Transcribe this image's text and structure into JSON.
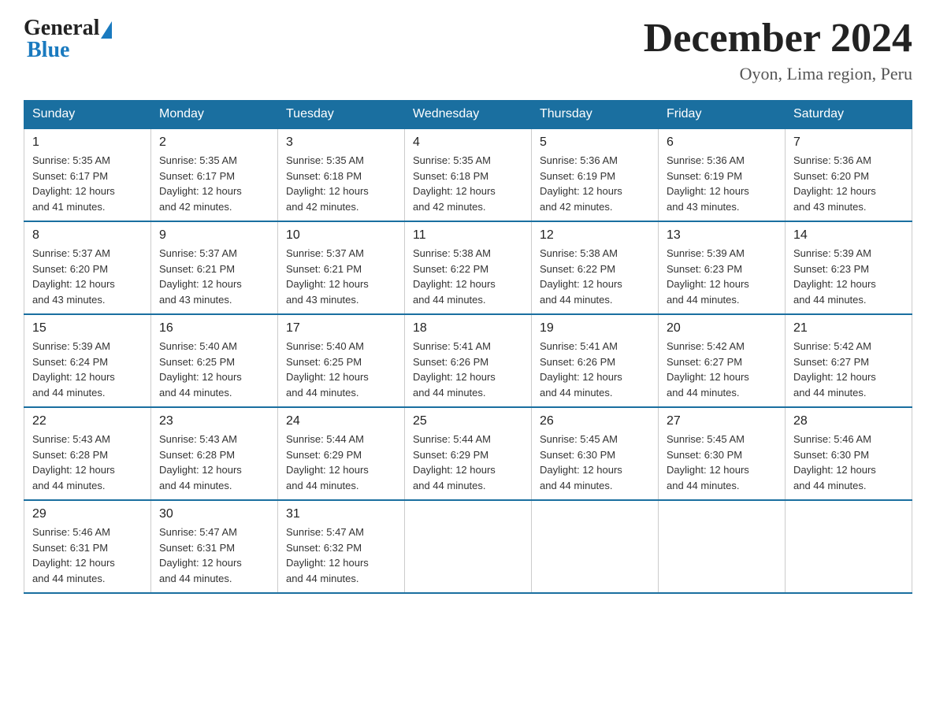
{
  "logo": {
    "general": "General",
    "blue": "Blue"
  },
  "title": {
    "month_year": "December 2024",
    "location": "Oyon, Lima region, Peru"
  },
  "headers": [
    "Sunday",
    "Monday",
    "Tuesday",
    "Wednesday",
    "Thursday",
    "Friday",
    "Saturday"
  ],
  "weeks": [
    [
      {
        "day": "1",
        "sunrise": "5:35 AM",
        "sunset": "6:17 PM",
        "daylight": "12 hours and 41 minutes."
      },
      {
        "day": "2",
        "sunrise": "5:35 AM",
        "sunset": "6:17 PM",
        "daylight": "12 hours and 42 minutes."
      },
      {
        "day": "3",
        "sunrise": "5:35 AM",
        "sunset": "6:18 PM",
        "daylight": "12 hours and 42 minutes."
      },
      {
        "day": "4",
        "sunrise": "5:35 AM",
        "sunset": "6:18 PM",
        "daylight": "12 hours and 42 minutes."
      },
      {
        "day": "5",
        "sunrise": "5:36 AM",
        "sunset": "6:19 PM",
        "daylight": "12 hours and 42 minutes."
      },
      {
        "day": "6",
        "sunrise": "5:36 AM",
        "sunset": "6:19 PM",
        "daylight": "12 hours and 43 minutes."
      },
      {
        "day": "7",
        "sunrise": "5:36 AM",
        "sunset": "6:20 PM",
        "daylight": "12 hours and 43 minutes."
      }
    ],
    [
      {
        "day": "8",
        "sunrise": "5:37 AM",
        "sunset": "6:20 PM",
        "daylight": "12 hours and 43 minutes."
      },
      {
        "day": "9",
        "sunrise": "5:37 AM",
        "sunset": "6:21 PM",
        "daylight": "12 hours and 43 minutes."
      },
      {
        "day": "10",
        "sunrise": "5:37 AM",
        "sunset": "6:21 PM",
        "daylight": "12 hours and 43 minutes."
      },
      {
        "day": "11",
        "sunrise": "5:38 AM",
        "sunset": "6:22 PM",
        "daylight": "12 hours and 44 minutes."
      },
      {
        "day": "12",
        "sunrise": "5:38 AM",
        "sunset": "6:22 PM",
        "daylight": "12 hours and 44 minutes."
      },
      {
        "day": "13",
        "sunrise": "5:39 AM",
        "sunset": "6:23 PM",
        "daylight": "12 hours and 44 minutes."
      },
      {
        "day": "14",
        "sunrise": "5:39 AM",
        "sunset": "6:23 PM",
        "daylight": "12 hours and 44 minutes."
      }
    ],
    [
      {
        "day": "15",
        "sunrise": "5:39 AM",
        "sunset": "6:24 PM",
        "daylight": "12 hours and 44 minutes."
      },
      {
        "day": "16",
        "sunrise": "5:40 AM",
        "sunset": "6:25 PM",
        "daylight": "12 hours and 44 minutes."
      },
      {
        "day": "17",
        "sunrise": "5:40 AM",
        "sunset": "6:25 PM",
        "daylight": "12 hours and 44 minutes."
      },
      {
        "day": "18",
        "sunrise": "5:41 AM",
        "sunset": "6:26 PM",
        "daylight": "12 hours and 44 minutes."
      },
      {
        "day": "19",
        "sunrise": "5:41 AM",
        "sunset": "6:26 PM",
        "daylight": "12 hours and 44 minutes."
      },
      {
        "day": "20",
        "sunrise": "5:42 AM",
        "sunset": "6:27 PM",
        "daylight": "12 hours and 44 minutes."
      },
      {
        "day": "21",
        "sunrise": "5:42 AM",
        "sunset": "6:27 PM",
        "daylight": "12 hours and 44 minutes."
      }
    ],
    [
      {
        "day": "22",
        "sunrise": "5:43 AM",
        "sunset": "6:28 PM",
        "daylight": "12 hours and 44 minutes."
      },
      {
        "day": "23",
        "sunrise": "5:43 AM",
        "sunset": "6:28 PM",
        "daylight": "12 hours and 44 minutes."
      },
      {
        "day": "24",
        "sunrise": "5:44 AM",
        "sunset": "6:29 PM",
        "daylight": "12 hours and 44 minutes."
      },
      {
        "day": "25",
        "sunrise": "5:44 AM",
        "sunset": "6:29 PM",
        "daylight": "12 hours and 44 minutes."
      },
      {
        "day": "26",
        "sunrise": "5:45 AM",
        "sunset": "6:30 PM",
        "daylight": "12 hours and 44 minutes."
      },
      {
        "day": "27",
        "sunrise": "5:45 AM",
        "sunset": "6:30 PM",
        "daylight": "12 hours and 44 minutes."
      },
      {
        "day": "28",
        "sunrise": "5:46 AM",
        "sunset": "6:30 PM",
        "daylight": "12 hours and 44 minutes."
      }
    ],
    [
      {
        "day": "29",
        "sunrise": "5:46 AM",
        "sunset": "6:31 PM",
        "daylight": "12 hours and 44 minutes."
      },
      {
        "day": "30",
        "sunrise": "5:47 AM",
        "sunset": "6:31 PM",
        "daylight": "12 hours and 44 minutes."
      },
      {
        "day": "31",
        "sunrise": "5:47 AM",
        "sunset": "6:32 PM",
        "daylight": "12 hours and 44 minutes."
      },
      null,
      null,
      null,
      null
    ]
  ],
  "labels": {
    "sunrise": "Sunrise:",
    "sunset": "Sunset:",
    "daylight": "Daylight:"
  },
  "colors": {
    "header_bg": "#1a6fa0",
    "accent": "#1a7abf"
  }
}
